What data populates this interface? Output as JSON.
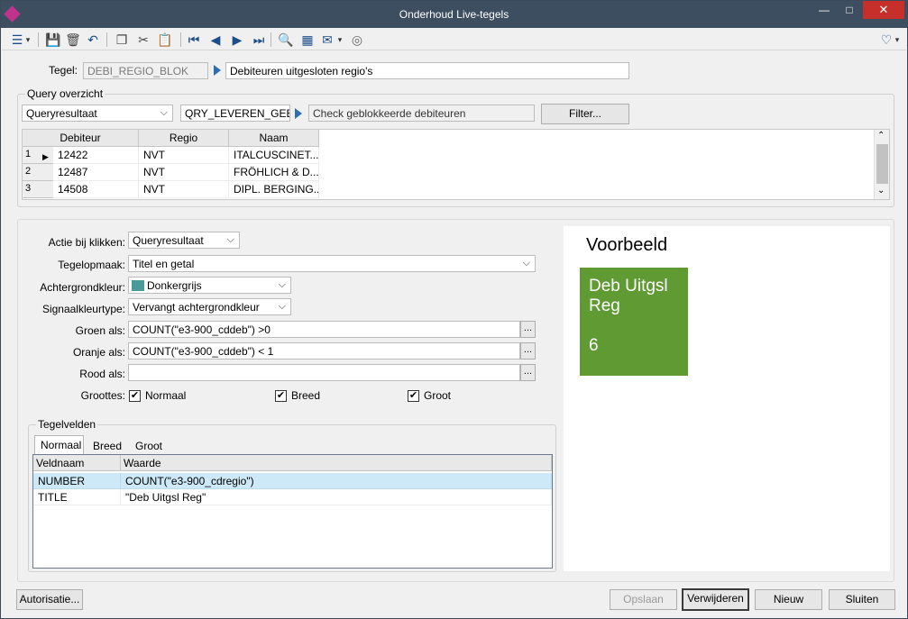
{
  "window": {
    "title": "Onderhoud Live-tegels"
  },
  "tegel": {
    "label": "Tegel:",
    "code": "DEBI_REGIO_BLOK",
    "description": "Debiteuren uitgesloten regio's"
  },
  "query": {
    "group_title": "Query overzicht",
    "type_value": "Queryresultaat",
    "query_name": "QRY_LEVEREN_GEB",
    "query_description": "Check geblokkeerde debiteuren",
    "filter_button": "Filter...",
    "columns": [
      "Debiteur",
      "Regio",
      "Naam"
    ],
    "rows": [
      {
        "num": "1",
        "debiteur": "12422",
        "regio": "NVT",
        "naam": "ITALCUSCINET..."
      },
      {
        "num": "2",
        "debiteur": "12487",
        "regio": "NVT",
        "naam": "FRÖHLICH & D..."
      },
      {
        "num": "3",
        "debiteur": "14508",
        "regio": "NVT",
        "naam": "DIPL. BERGING..."
      }
    ]
  },
  "form": {
    "actie_label": "Actie bij klikken:",
    "actie_value": "Queryresultaat",
    "opmaak_label": "Tegelopmaak:",
    "opmaak_value": "Titel en getal",
    "achtergrond_label": "Achtergrondkleur:",
    "achtergrond_value": "Donkergrijs",
    "achtergrond_swatch": "#4a9a9a",
    "signaal_label": "Signaalkleurtype:",
    "signaal_value": "Vervangt achtergrondkleur",
    "groen_label": "Groen als:",
    "groen_value": "COUNT(\"e3-900_cddeb\") >0",
    "oranje_label": "Oranje als:",
    "oranje_value": "COUNT(\"e3-900_cddeb\") < 1",
    "rood_label": "Rood als:",
    "rood_value": "",
    "ellipsis": "...",
    "groottes_label": "Groottes:",
    "sizes": [
      {
        "label": "Normaal",
        "checked": true
      },
      {
        "label": "Breed",
        "checked": true
      },
      {
        "label": "Groot",
        "checked": true
      }
    ]
  },
  "tegelvelden": {
    "group_title": "Tegelvelden",
    "tabs": [
      "Normaal",
      "Breed",
      "Groot"
    ],
    "columns": [
      "Veldnaam",
      "Waarde"
    ],
    "rows": [
      {
        "veldnaam": "NUMBER",
        "waarde": "COUNT(\"e3-900_cdregio\")"
      },
      {
        "veldnaam": "TITLE",
        "waarde": "\"Deb Uitgsl Reg\""
      }
    ]
  },
  "preview": {
    "title": "Voorbeeld",
    "tile_title": "Deb Uitgsl Reg",
    "tile_number": "6",
    "tile_color": "#5f9a33"
  },
  "footer": {
    "autorisatie": "Autorisatie...",
    "opslaan": "Opslaan",
    "verwijderen": "Verwijderen",
    "nieuw": "Nieuw",
    "sluiten": "Sluiten"
  }
}
